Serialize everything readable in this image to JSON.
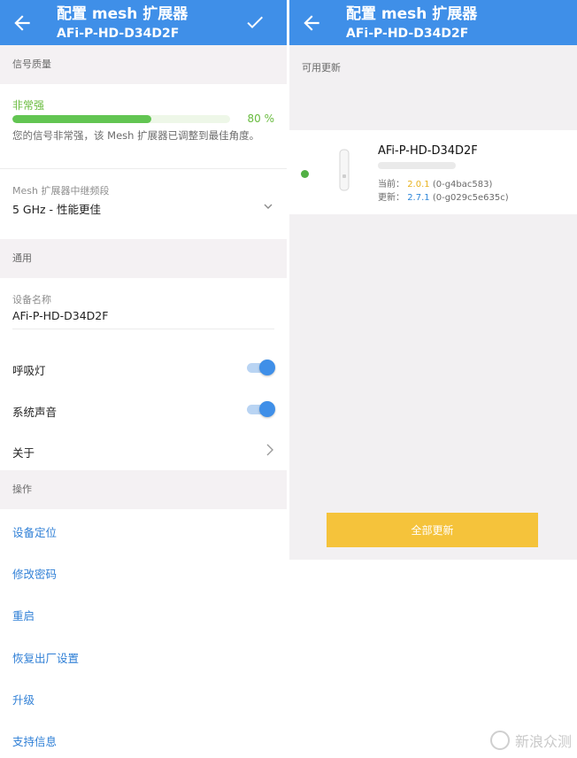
{
  "left": {
    "header": {
      "title": "配置 mesh 扩展器",
      "subtitle": "AFi-P-HD-D34D2F"
    },
    "icons": {
      "back": "arrow-left-icon",
      "confirm": "check-icon"
    },
    "signal": {
      "section_title": "信号质量",
      "strength_label": "非常强",
      "percent": 80,
      "percent_text": "80 %",
      "description": "您的信号非常强，该 Mesh 扩展器已调整到最佳角度。",
      "band_label": "Mesh 扩展器中继频段",
      "band_value": "5 GHz - 性能更佳"
    },
    "general": {
      "section_title": "通用",
      "device_name_label": "设备名称",
      "device_name_value": "AFi-P-HD-D34D2F",
      "breathing_light_label": "呼吸灯",
      "breathing_light_on": true,
      "system_sound_label": "系统声音",
      "system_sound_on": true,
      "about_label": "关于"
    },
    "actions": {
      "section_title": "操作",
      "items": [
        "设备定位",
        "修改密码",
        "重启",
        "恢复出厂设置",
        "升级",
        "支持信息"
      ]
    }
  },
  "right": {
    "header": {
      "title": "配置 mesh 扩展器",
      "subtitle": "AFi-P-HD-D34D2F"
    },
    "section_title": "可用更新",
    "update": {
      "device_name": "AFi-P-HD-D34D2F",
      "current_label": "当前：",
      "current_version": "2.0.1",
      "current_build": "(0-g4bac583)",
      "new_label": "更新：",
      "new_version": "2.7.1",
      "new_build": "(0-g029c5e635c)"
    },
    "update_all_button": "全部更新"
  },
  "watermark": "新浪众测",
  "colors": {
    "accent": "#3f8fe8",
    "signal_green": "#62c552",
    "update_yellow": "#f5c33b",
    "link_blue": "#2f7fd6"
  }
}
